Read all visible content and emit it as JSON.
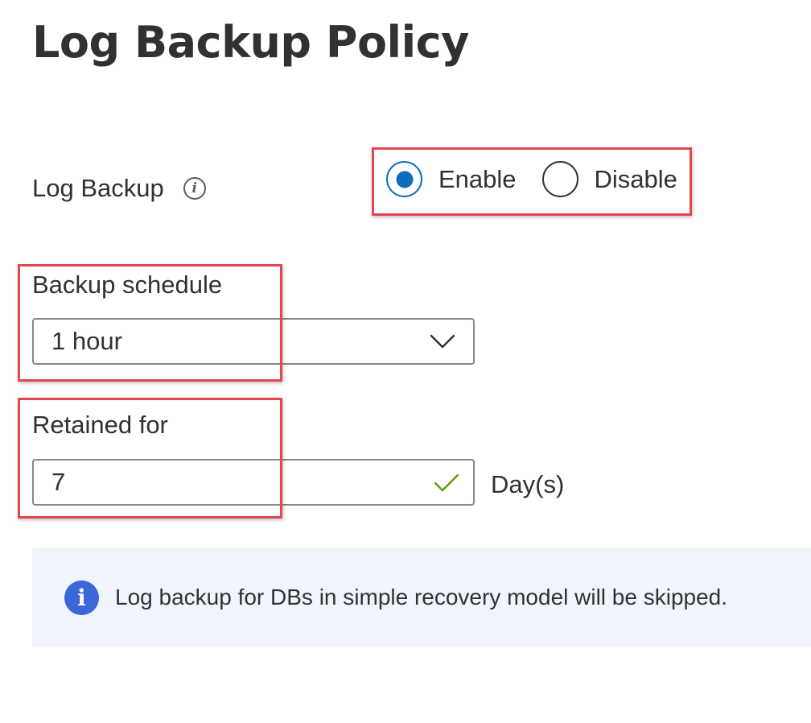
{
  "page": {
    "title": "Log Backup Policy"
  },
  "log_backup": {
    "label": "Log Backup",
    "info_icon": "info-icon",
    "options": [
      {
        "label": "Enable",
        "selected": true
      },
      {
        "label": "Disable",
        "selected": false
      }
    ]
  },
  "backup_schedule": {
    "label": "Backup schedule",
    "value": "1 hour"
  },
  "retention": {
    "label": "Retained for",
    "value": "7",
    "units": "Day(s)",
    "valid": true
  },
  "info_banner": {
    "icon": "info-icon",
    "text": "Log backup for DBs in simple recovery model will be skipped."
  },
  "colors": {
    "accent": "#0f6cbd",
    "highlight": "#e5454e",
    "banner_bg": "#f0f5fd",
    "valid_check": "#57a300"
  }
}
